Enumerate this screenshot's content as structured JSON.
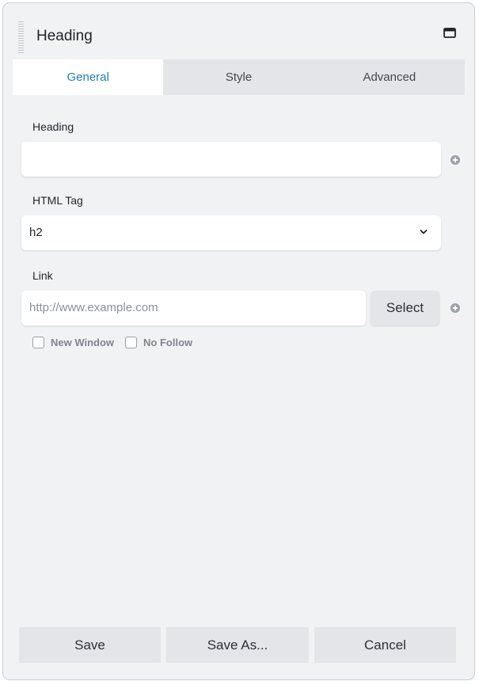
{
  "panel": {
    "title": "Heading"
  },
  "tabs": [
    {
      "label": "General",
      "active": true
    },
    {
      "label": "Style",
      "active": false
    },
    {
      "label": "Advanced",
      "active": false
    }
  ],
  "fields": {
    "heading": {
      "label": "Heading",
      "value": ""
    },
    "html_tag": {
      "label": "HTML Tag",
      "selected": "h2"
    },
    "link": {
      "label": "Link",
      "value": "",
      "placeholder": "http://www.example.com",
      "select_label": "Select",
      "new_window_label": "New Window",
      "new_window_checked": false,
      "no_follow_label": "No Follow",
      "no_follow_checked": false
    }
  },
  "footer": {
    "save_label": "Save",
    "save_as_label": "Save As...",
    "cancel_label": "Cancel"
  },
  "colors": {
    "accent": "#1e7fb6",
    "panel_bg": "#f1f2f4",
    "button_bg": "#e3e5e8"
  }
}
